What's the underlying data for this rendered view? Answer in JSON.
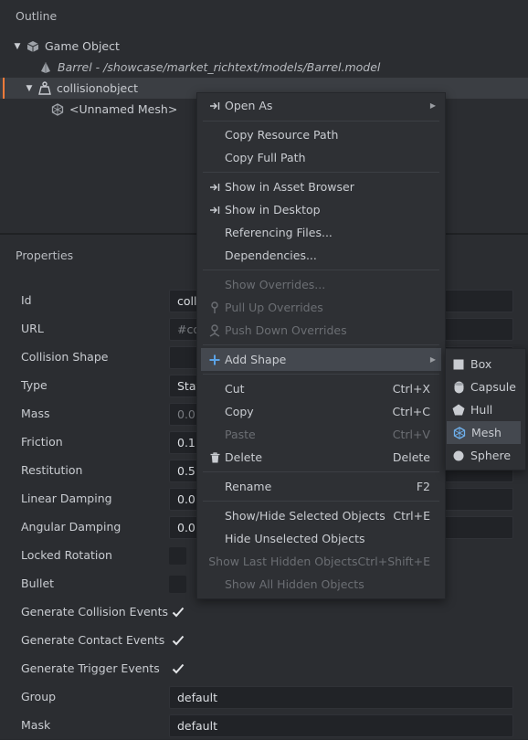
{
  "outline": {
    "title": "Outline",
    "items": [
      {
        "label": "Game Object",
        "icon": "cube-icon"
      },
      {
        "label": "Barrel - /showcase/market_richtext/models/Barrel.model",
        "icon": "model-icon"
      },
      {
        "label": "collisionobject",
        "icon": "weight-icon"
      },
      {
        "label": "<Unnamed Mesh>",
        "icon": "mesh-icon"
      }
    ]
  },
  "properties": {
    "title": "Properties",
    "rows": [
      {
        "label": "Id",
        "value": "coll"
      },
      {
        "label": "URL",
        "value": "#co"
      },
      {
        "label": "Collision Shape",
        "value": ""
      },
      {
        "label": "Type",
        "value": "Stat"
      },
      {
        "label": "Mass",
        "value": "0.0"
      },
      {
        "label": "Friction",
        "value": "0.1"
      },
      {
        "label": "Restitution",
        "value": "0.5"
      },
      {
        "label": "Linear Damping",
        "value": "0.0"
      },
      {
        "label": "Angular Damping",
        "value": "0.0"
      },
      {
        "label": "Locked Rotation",
        "checked": false
      },
      {
        "label": "Bullet",
        "checked": false
      },
      {
        "label": "Generate Collision Events",
        "checked": true
      },
      {
        "label": "Generate Contact Events",
        "checked": true
      },
      {
        "label": "Generate Trigger Events",
        "checked": true
      },
      {
        "label": "Group",
        "value": "default"
      },
      {
        "label": "Mask",
        "value": "default"
      }
    ]
  },
  "context_menu": {
    "items": [
      {
        "label": "Open As",
        "icon": "arrow-into-icon",
        "submenu": true
      },
      {
        "label": "Copy Resource Path"
      },
      {
        "label": "Copy Full Path"
      },
      {
        "label": "Show in Asset Browser",
        "icon": "arrow-into-icon"
      },
      {
        "label": "Show in Desktop",
        "icon": "arrow-into-icon"
      },
      {
        "label": "Referencing Files..."
      },
      {
        "label": "Dependencies..."
      },
      {
        "label": "Show Overrides...",
        "disabled": true
      },
      {
        "label": "Pull Up Overrides",
        "icon": "pull-up-icon",
        "disabled": true
      },
      {
        "label": "Push Down Overrides",
        "icon": "push-down-icon",
        "disabled": true
      },
      {
        "label": "Add Shape",
        "icon": "plus-icon",
        "submenu": true,
        "highlighted": true
      },
      {
        "label": "Cut",
        "shortcut": "Ctrl+X"
      },
      {
        "label": "Copy",
        "shortcut": "Ctrl+C"
      },
      {
        "label": "Paste",
        "shortcut": "Ctrl+V",
        "disabled": true
      },
      {
        "label": "Delete",
        "shortcut": "Delete",
        "icon": "trash-icon"
      },
      {
        "label": "Rename",
        "shortcut": "F2"
      },
      {
        "label": "Show/Hide Selected Objects",
        "shortcut": "Ctrl+E"
      },
      {
        "label": "Hide Unselected Objects"
      },
      {
        "label": "Show Last Hidden Objects",
        "shortcut": "Ctrl+Shift+E",
        "disabled": true
      },
      {
        "label": "Show All Hidden Objects",
        "disabled": true
      }
    ]
  },
  "shape_submenu": {
    "items": [
      {
        "label": "Box",
        "icon": "box-icon"
      },
      {
        "label": "Capsule",
        "icon": "capsule-icon"
      },
      {
        "label": "Hull",
        "icon": "hull-icon"
      },
      {
        "label": "Mesh",
        "icon": "mesh-icon",
        "highlighted": true
      },
      {
        "label": "Sphere",
        "icon": "sphere-icon"
      }
    ]
  },
  "colors": {
    "accent": "#f57a39",
    "background": "#2b2d31",
    "menu": "#2e3034",
    "highlight": "#44484f",
    "plus": "#5ba3e6"
  }
}
